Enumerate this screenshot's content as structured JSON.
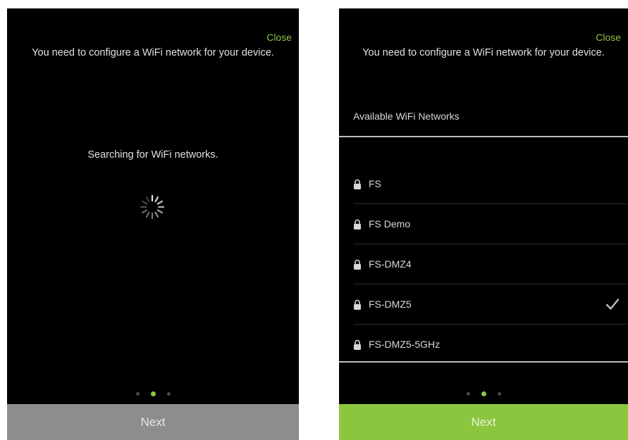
{
  "left_screen": {
    "close_label": "Close",
    "instruction": "You need to configure a WiFi network for your device.",
    "searching_text": "Searching for WiFi networks.",
    "page_indicator": {
      "count": 3,
      "active_index": 1
    },
    "next_label": "Next"
  },
  "right_screen": {
    "close_label": "Close",
    "instruction": "You need to configure a WiFi network for your device.",
    "list_header": "Available WiFi Networks",
    "networks": [
      {
        "ssid": "FS",
        "secured": true,
        "selected": false
      },
      {
        "ssid": "FS Demo",
        "secured": true,
        "selected": false
      },
      {
        "ssid": "FS-DMZ4",
        "secured": true,
        "selected": false
      },
      {
        "ssid": "FS-DMZ5",
        "secured": true,
        "selected": true
      },
      {
        "ssid": "FS-DMZ5-5GHz",
        "secured": true,
        "selected": false
      }
    ],
    "page_indicator": {
      "count": 3,
      "active_index": 1
    },
    "next_label": "Next"
  },
  "colors": {
    "accent": "#8cc63f",
    "screen_background": "#000000",
    "disabled_button": "#8d8d8d",
    "text": "#e0e0e0"
  },
  "icons": {
    "spinner": "loading-spinner-icon",
    "lock": "lock-icon",
    "check": "checkmark-icon"
  }
}
